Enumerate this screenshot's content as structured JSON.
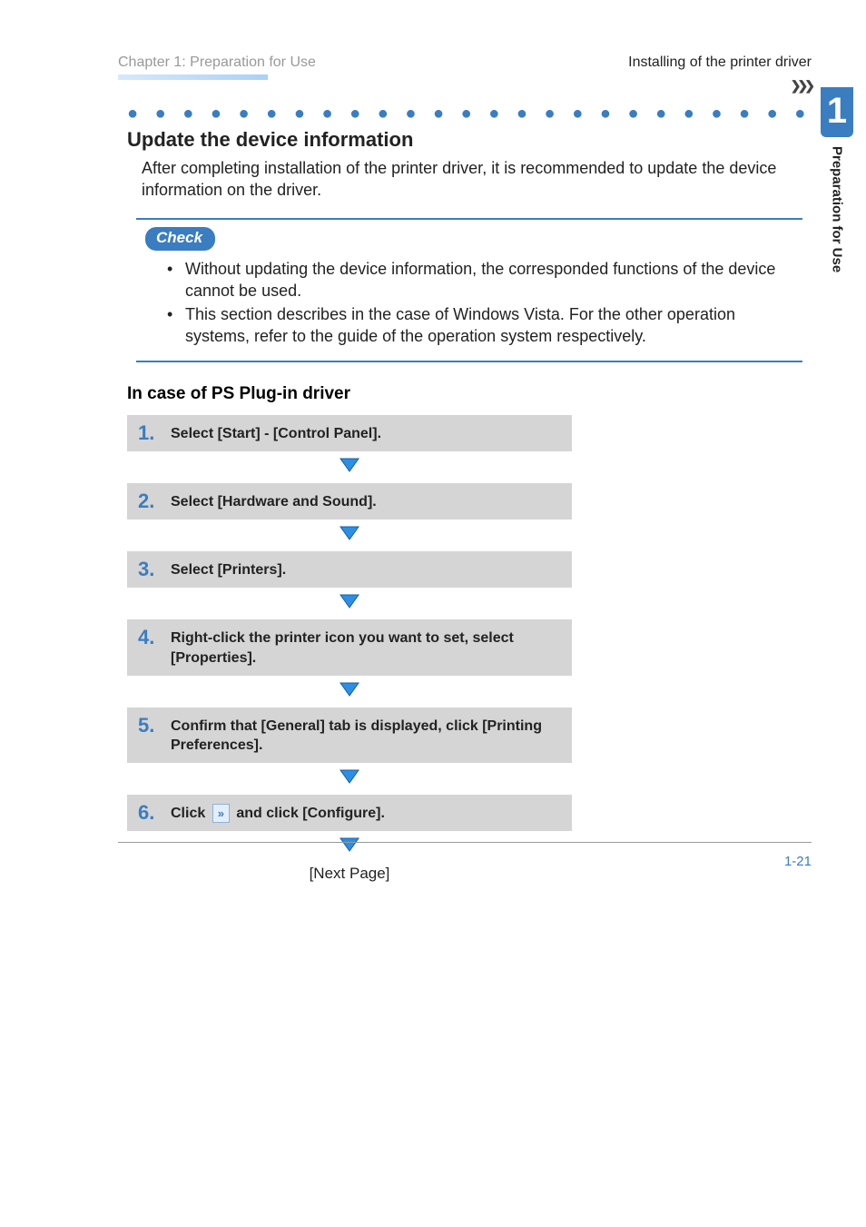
{
  "header": {
    "chapter": "Chapter 1: Preparation for Use",
    "topic": "Installing of the printer driver"
  },
  "sidebar": {
    "number": "1",
    "label": "Preparation for Use"
  },
  "section": {
    "title": "Update the device information",
    "description": "After completing installation of the printer driver, it is recommended to update the device information on the driver."
  },
  "check": {
    "badge": "Check",
    "items": [
      "Without updating the device information, the corresponded functions of the device cannot be used.",
      "This section describes in the case of Windows Vista. For the other operation systems, refer to the guide of the operation system respectively."
    ]
  },
  "subsection": {
    "title": "In case of PS Plug-in driver"
  },
  "steps": [
    {
      "num": "1.",
      "text": "Select [Start] - [Control Panel]."
    },
    {
      "num": "2.",
      "text": "Select [Hardware and Sound]."
    },
    {
      "num": "3.",
      "text": "Select [Printers]."
    },
    {
      "num": "4.",
      "text": "Right-click the printer icon you want to set, select [Properties]."
    },
    {
      "num": "5.",
      "text": "Confirm that [General] tab is displayed, click [Printing Preferences]."
    }
  ],
  "step6": {
    "num": "6.",
    "prefix": "Click ",
    "suffix": " and click [Configure].",
    "icon_glyph": "»"
  },
  "next_page": "[Next Page]",
  "footer": {
    "page": "1-21"
  },
  "dots": "● ● ● ● ● ● ● ● ● ● ● ● ● ● ● ● ● ● ● ● ● ● ● ● ● ● ● ● ● ● ● ● ● ● ● ● ● ● ● ● ● ● ● ● ●",
  "chevrons": "❯❯❯"
}
